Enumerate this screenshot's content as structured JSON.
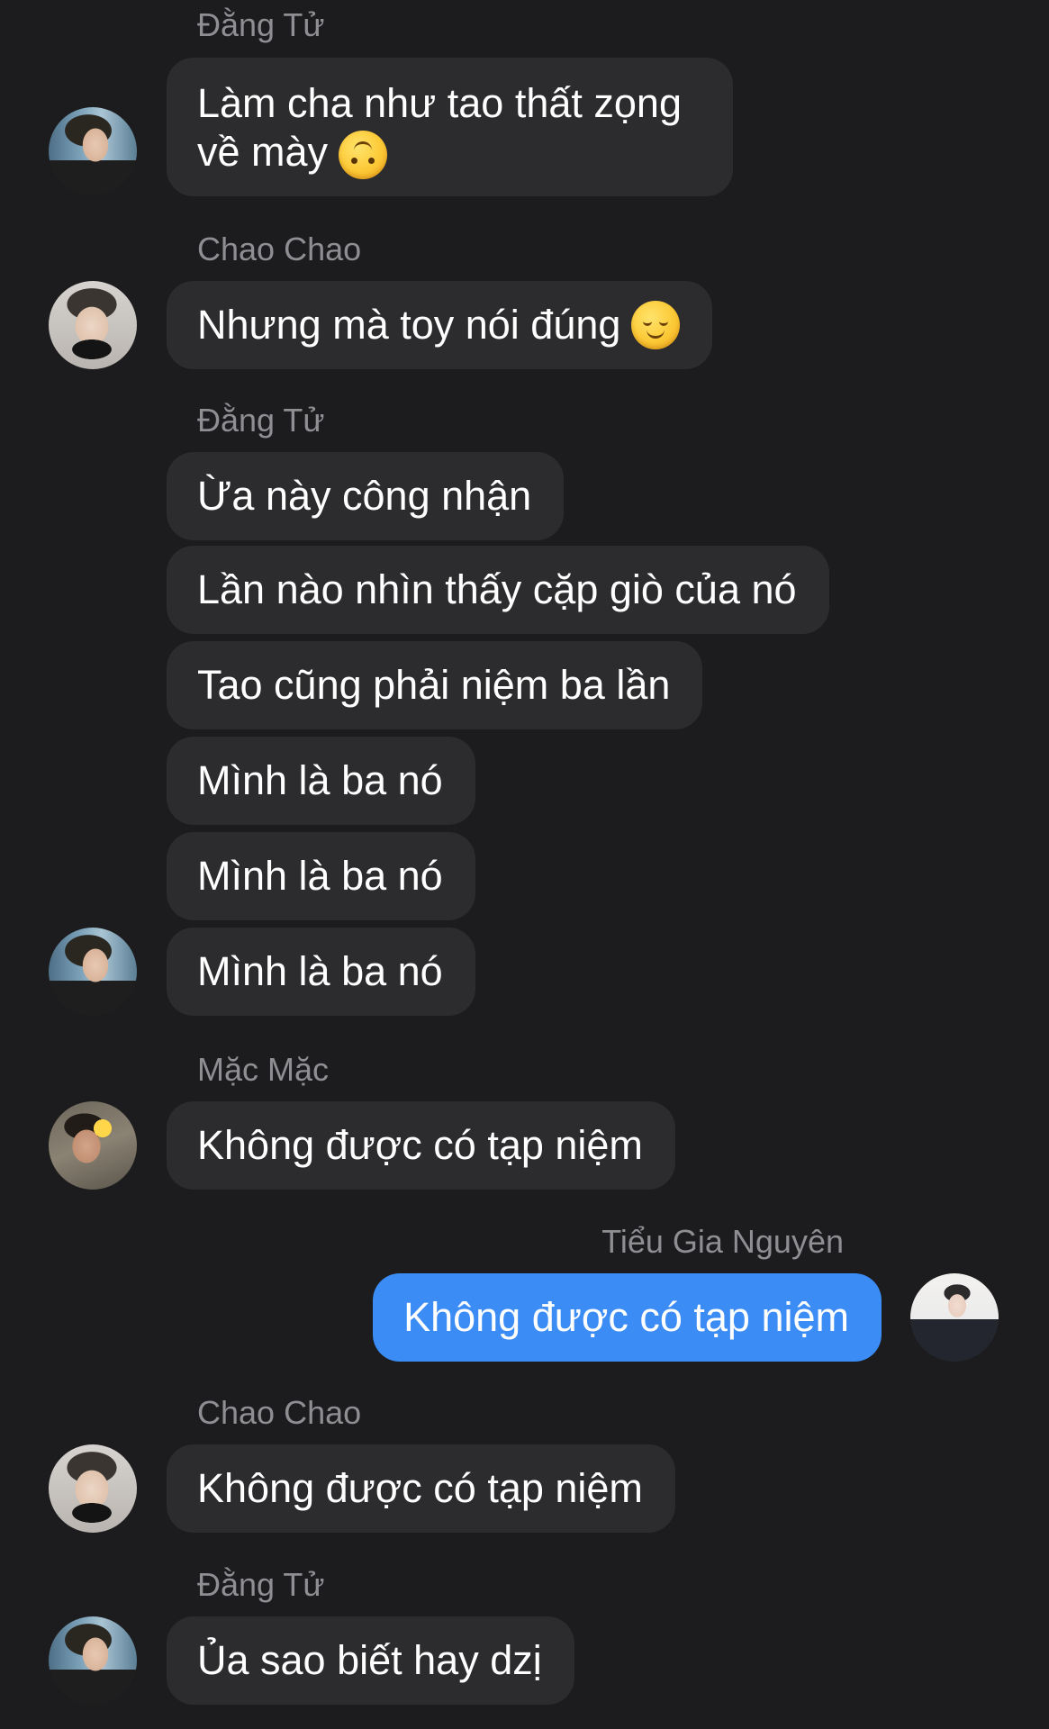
{
  "messages": [
    {
      "sender": "Đằng Tử",
      "bubbles": [
        "Làm cha như tao thất zọng về mày"
      ],
      "emoji": "upside-down-face-emoji"
    },
    {
      "sender": "Chao Chao",
      "bubbles": [
        "Nhưng mà toy nói đúng"
      ],
      "emoji": "relieved-face-emoji"
    },
    {
      "sender": "Đằng Tử",
      "bubbles": [
        "Ừa này công nhận",
        "Lần nào nhìn thấy cặp giò của nó",
        "Tao cũng phải niệm ba lần",
        "Mình là ba nó",
        "Mình là ba nó",
        "Mình là ba nó"
      ]
    },
    {
      "sender": "Mặc Mặc",
      "bubbles": [
        "Không được có tạp niệm"
      ]
    },
    {
      "sender": "Tiểu Gia Nguyên",
      "self": true,
      "bubbles": [
        "Không được có tạp niệm"
      ]
    },
    {
      "sender": "Chao Chao",
      "bubbles": [
        "Không được có tạp niệm"
      ]
    },
    {
      "sender": "Đằng Tử",
      "bubbles": [
        "Ủa sao biết hay dzị"
      ]
    }
  ],
  "colors": {
    "background": "#1c1c1e",
    "bubble_incoming": "#2c2c2e",
    "bubble_outgoing": "#3b8cf5",
    "sender_name": "#8e8e93",
    "text": "#ffffff"
  }
}
